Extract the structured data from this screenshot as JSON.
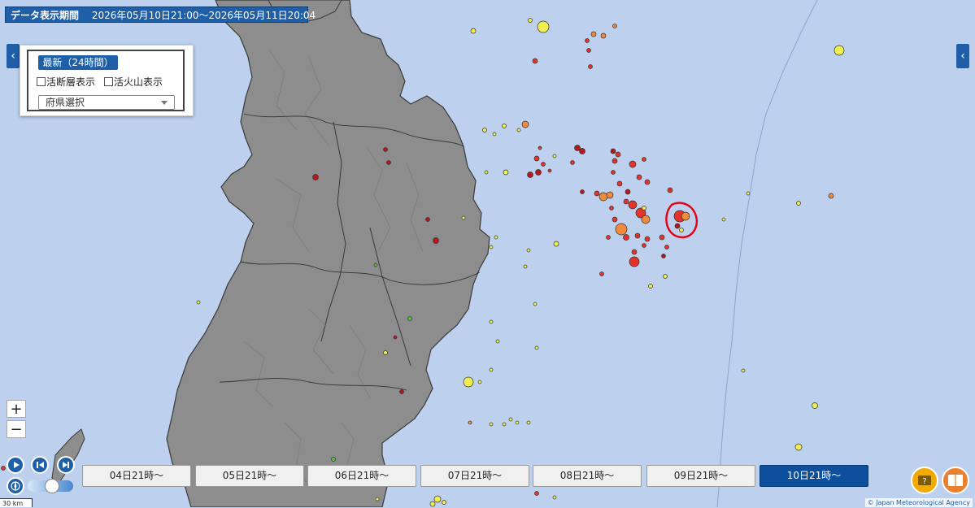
{
  "header": {
    "period_label": "データ表示期間",
    "period_value": "2026年05月10日21:00～2026年05月11日20:04"
  },
  "panel": {
    "latest_label": "最新（24時間）",
    "fault_label": "活断層表示",
    "volcano_label": "活火山表示",
    "prefecture_select": "府県選択"
  },
  "controls": {
    "zoom_in": "+",
    "zoom_out": "−",
    "left_tab": "‹",
    "right_tab": "‹"
  },
  "timeline": {
    "buttons": [
      "04日21時～",
      "05日21時～",
      "06日21時～",
      "07日21時～",
      "08日21時～",
      "09日21時～",
      "10日21時～"
    ],
    "active_index": 6
  },
  "scale": {
    "label": "30 km"
  },
  "credit": {
    "text": "© Japan Meteorological Agency"
  },
  "colors": {
    "sea": "#bdd1ef",
    "land": "#8d8d8d",
    "accent": "#1f5fa8",
    "quake_deep_red": "#b7161c",
    "quake_red": "#e6332a",
    "quake_orange": "#f08a3c",
    "quake_yellow": "#f1ee4f",
    "quake_green": "#5fc03a",
    "highlight_circle": "#e60012"
  },
  "icons": {
    "play": "play-icon",
    "step_back": "step-back-icon",
    "step_forward": "step-forward-icon",
    "compass": "compass-icon",
    "help": "help-icon",
    "legend": "legend-book-icon"
  }
}
